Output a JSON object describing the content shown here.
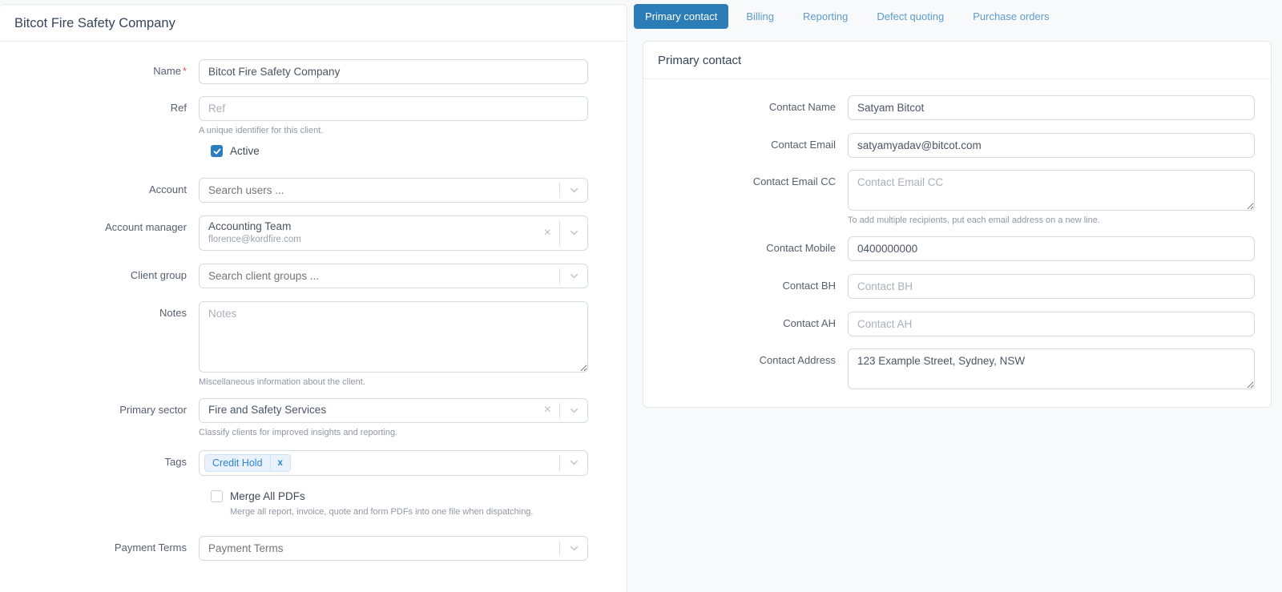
{
  "client_form": {
    "title": "Bitcot Fire Safety Company",
    "required_marker": "*",
    "name": {
      "label": "Name",
      "value": "Bitcot Fire Safety Company"
    },
    "ref": {
      "label": "Ref",
      "placeholder": "Ref",
      "hint": "A unique identifier for this client."
    },
    "active": {
      "label": "Active",
      "checked": true
    },
    "account": {
      "label": "Account",
      "placeholder": "Search users ..."
    },
    "account_manager": {
      "label": "Account manager",
      "value": "Accounting Team",
      "value_sub": "florence@kordfire.com"
    },
    "client_group": {
      "label": "Client group",
      "placeholder": "Search client groups ..."
    },
    "notes": {
      "label": "Notes",
      "placeholder": "Notes",
      "hint": "Miscellaneous information about the client."
    },
    "primary_sector": {
      "label": "Primary sector",
      "value": "Fire and Safety Services",
      "hint": "Classify clients for improved insights and reporting."
    },
    "tags": {
      "label": "Tags",
      "tag": "Credit Hold"
    },
    "merge_all_pdfs": {
      "label": "Merge All PDFs",
      "checked": false,
      "hint": "Merge all report, invoice, quote and form PDFs into one file when dispatching."
    },
    "payment_terms": {
      "label": "Payment Terms",
      "placeholder": "Payment Terms"
    }
  },
  "tabs": {
    "active": "Primary contact",
    "items": [
      "Primary contact",
      "Billing",
      "Reporting",
      "Defect quoting",
      "Purchase orders"
    ]
  },
  "contact_card": {
    "title": "Primary contact",
    "contact_name": {
      "label": "Contact Name",
      "value": "Satyam Bitcot"
    },
    "contact_email": {
      "label": "Contact Email",
      "value": "satyamyadav@bitcot.com"
    },
    "contact_email_cc": {
      "label": "Contact Email CC",
      "placeholder": "Contact Email CC",
      "hint": "To add multiple recipients, put each email address on a new line."
    },
    "contact_mobile": {
      "label": "Contact Mobile",
      "value": "0400000000"
    },
    "contact_bh": {
      "label": "Contact BH",
      "placeholder": "Contact BH"
    },
    "contact_ah": {
      "label": "Contact AH",
      "placeholder": "Contact AH"
    },
    "contact_address": {
      "label": "Contact Address",
      "value": "123 Example Street, Sydney, NSW"
    }
  },
  "icons": {
    "clear": "×",
    "tag_remove": "x"
  },
  "colors": {
    "accent_blue": "#2c7cb7",
    "tab_inactive_text": "#5b9ccd",
    "checkbox_blue": "#2b7dbd",
    "tag_text": "#2b84d6",
    "tag_bg": "#e9f2fc",
    "required_red": "#e0565a"
  }
}
